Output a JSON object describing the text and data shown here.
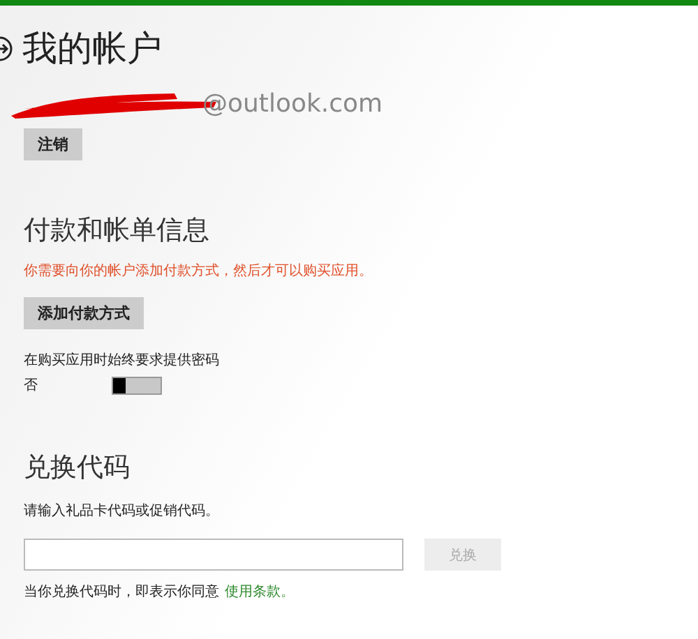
{
  "page": {
    "title": "我的帐户"
  },
  "account": {
    "email": "@outlook.com",
    "sign_out_button": "注销"
  },
  "payment": {
    "heading": "付款和帐单信息",
    "warning": "你需要向你的帐户添加付款方式，然后才可以购买应用。",
    "add_button": "添加付款方式",
    "password_label": "在购买应用时始终要求提供密码",
    "password_state": "否",
    "password_required": false
  },
  "redeem": {
    "heading": "兑换代码",
    "hint": "请输入礼品卡代码或促销代码。",
    "button": "兑换",
    "button_disabled": true,
    "terms_text": "当你兑换代码时，即表示你同意",
    "terms_link": "使用条款。"
  }
}
